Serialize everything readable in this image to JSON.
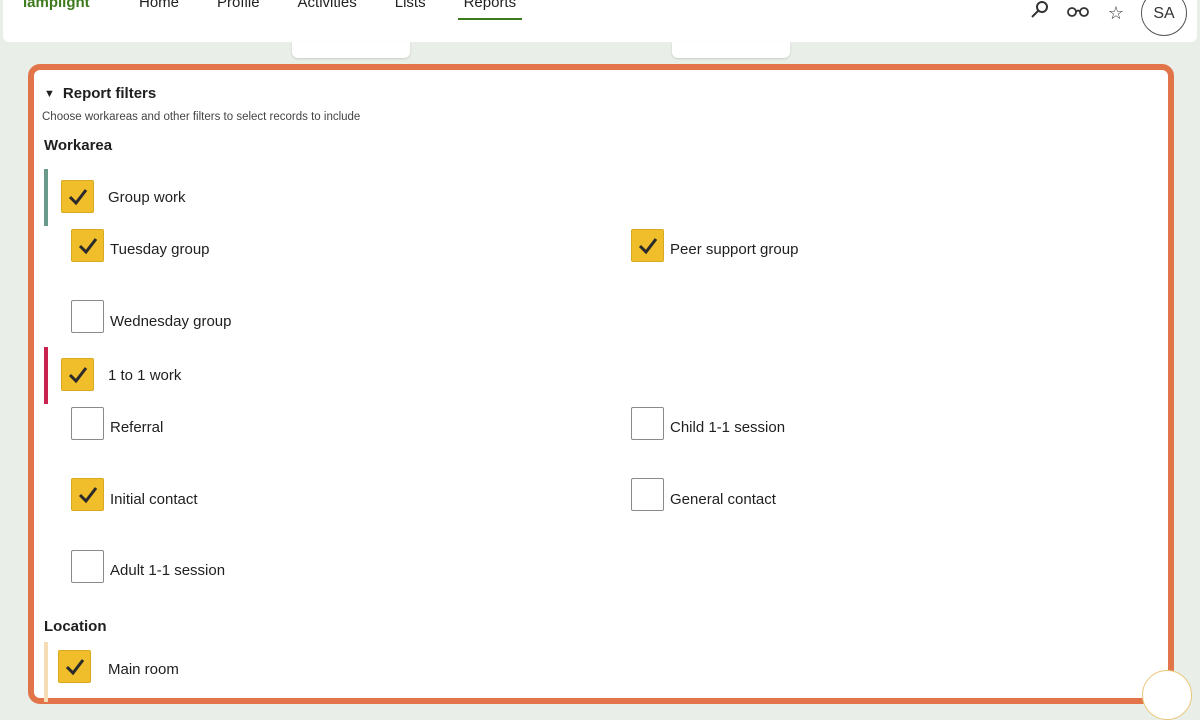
{
  "header": {
    "logo": "lamplight",
    "nav": [
      "Home",
      "Profile",
      "Activities",
      "Lists",
      "Reports"
    ],
    "active_nav": "Reports",
    "avatar": "SA"
  },
  "filters": {
    "summary": "Report filters",
    "subtitle": "Choose workareas and other filters to select records to include",
    "workarea_title": "Workarea",
    "location_title": "Location",
    "groups": {
      "group_work": {
        "label": "Group work",
        "checked": true,
        "color": "#6a9a8b"
      },
      "tuesday": {
        "label": "Tuesday group",
        "checked": true
      },
      "peer": {
        "label": "Peer support group",
        "checked": true
      },
      "wednesday": {
        "label": "Wednesday group",
        "checked": false
      },
      "one_to_one": {
        "label": "1 to 1 work",
        "checked": true,
        "color": "#c8234e"
      },
      "referral": {
        "label": "Referral",
        "checked": false
      },
      "child": {
        "label": "Child 1-1 session",
        "checked": false
      },
      "initial": {
        "label": "Initial contact",
        "checked": true
      },
      "general": {
        "label": "General contact",
        "checked": false
      },
      "adult": {
        "label": "Adult 1-1 session",
        "checked": false
      },
      "main_room": {
        "label": "Main room",
        "checked": true,
        "color": "#f4dcb4"
      }
    }
  },
  "colors": {
    "accent": "#e2744a",
    "checkbox_fill": "#efbe2a",
    "brand_green": "#3d7a1c"
  }
}
